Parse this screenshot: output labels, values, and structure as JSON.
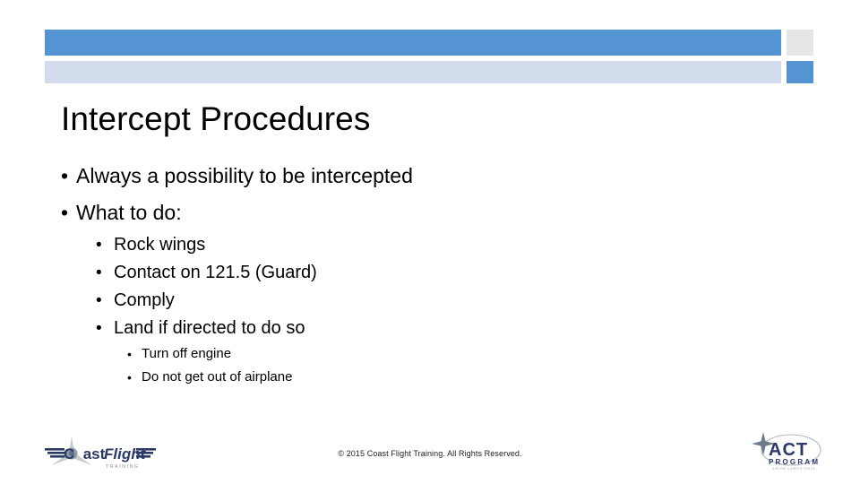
{
  "slide": {
    "title": "Intercept Procedures",
    "bullets_level1": [
      {
        "text": "Always a possibility to be intercepted"
      },
      {
        "text": "What to do:"
      }
    ],
    "bullets_level2": [
      {
        "text": "Rock wings"
      },
      {
        "text": "Contact on 121.5 (Guard)"
      },
      {
        "text": "Comply"
      },
      {
        "text": "Land if directed to do so"
      }
    ],
    "bullets_level3": [
      {
        "text": "Turn off engine"
      },
      {
        "text": "Do not get out of airplane"
      }
    ],
    "bullet_glyph": "•"
  },
  "footer": {
    "copyright": "© 2015 Coast Flight Training. All Rights Reserved."
  },
  "logos": {
    "coast_flight": {
      "name": "coast-flight-training-logo",
      "word_coast": "C  ast",
      "word_flight": "Flight",
      "tagline": "T R A I N I N G"
    },
    "act": {
      "name": "act-program-logo",
      "acronym": "ACT",
      "word_program": "PROGRAM",
      "tagline": "AIRLINE CAREER TRACK"
    }
  },
  "colors": {
    "accent_blue": "#5494D2",
    "light_blue": "#D2DCED",
    "gray_block": "#E6E6E6",
    "text": "#000000",
    "logo_navy": "#2B3A67",
    "logo_gray": "#9AA3AD"
  }
}
